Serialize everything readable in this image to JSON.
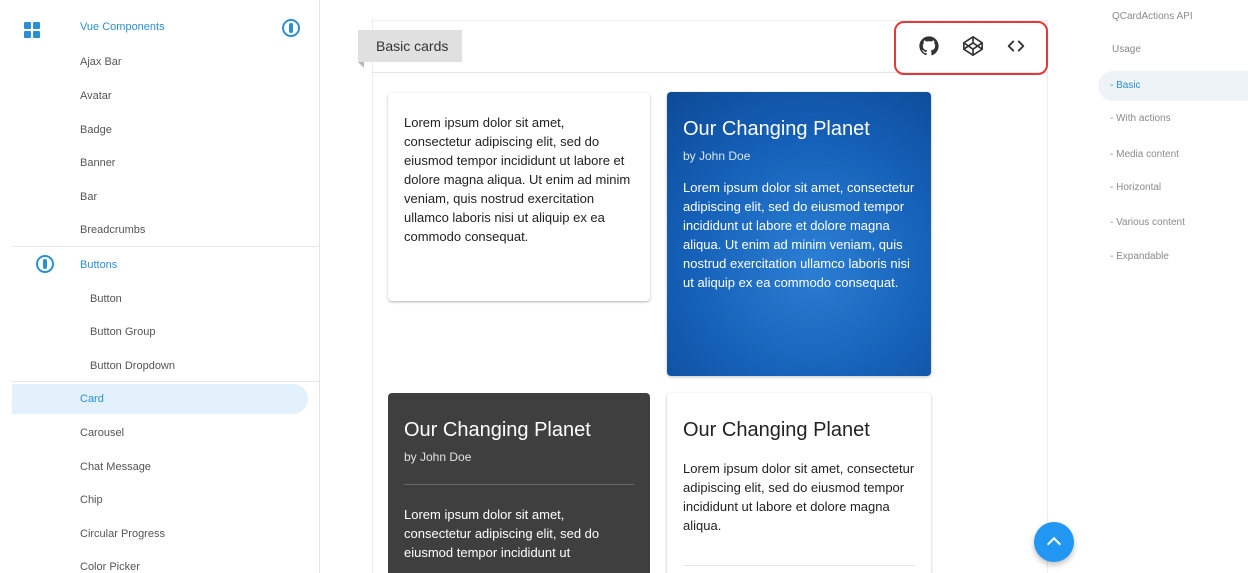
{
  "sidebar": {
    "section_label": "Vue Components",
    "items": [
      {
        "label": "Ajax Bar"
      },
      {
        "label": "Avatar"
      },
      {
        "label": "Badge"
      },
      {
        "label": "Banner"
      },
      {
        "label": "Bar"
      },
      {
        "label": "Breadcrumbs"
      }
    ],
    "group_label": "Buttons",
    "group_items": [
      {
        "label": "Button"
      },
      {
        "label": "Button Group"
      },
      {
        "label": "Button Dropdown"
      }
    ],
    "items2": [
      {
        "label": "Card"
      },
      {
        "label": "Carousel"
      },
      {
        "label": "Chat Message"
      },
      {
        "label": "Chip"
      },
      {
        "label": "Circular Progress"
      },
      {
        "label": "Color Picker"
      }
    ],
    "active_item": "Card",
    "accent_color": "#2b8fd6"
  },
  "main": {
    "section_title": "Basic cards",
    "icons": [
      "github-icon",
      "codepen-icon",
      "code-icon"
    ],
    "cards": [
      {
        "text": "Lorem ipsum dolor sit amet, consectetur adipiscing elit, sed do eiusmod tempor incididunt ut labore et dolore magna aliqua. Ut enim ad minim veniam, quis nostrud exercitation ullamco laboris nisi ut aliquip ex ea commodo consequat."
      },
      {
        "title": "Our Changing Planet",
        "subtitle": "by John Doe",
        "text": "Lorem ipsum dolor sit amet, consectetur adipiscing elit, sed do eiusmod tempor incididunt ut labore et dolore magna aliqua. Ut enim ad minim veniam, quis nostrud exercitation ullamco laboris nisi ut aliquip ex ea commodo consequat.",
        "color": "#1565c0"
      },
      {
        "title": "Our Changing Planet",
        "subtitle": "by John Doe",
        "text": "Lorem ipsum dolor sit amet, consectetur adipiscing elit, sed do eiusmod tempor incididunt ut",
        "color": "#3f3f3f"
      },
      {
        "title": "Our Changing Planet",
        "text": "Lorem ipsum dolor sit amet, consectetur adipiscing elit, sed do eiusmod tempor incididunt ut labore et dolore magna aliqua."
      }
    ]
  },
  "toc": {
    "items": [
      {
        "label": "QCardActions API"
      },
      {
        "label": "Usage"
      },
      {
        "label": "- Basic"
      },
      {
        "label": "- With actions"
      },
      {
        "label": "- Media content"
      },
      {
        "label": "- Horizontal"
      },
      {
        "label": "- Various content"
      },
      {
        "label": "- Expandable"
      }
    ],
    "active_item": "- Basic"
  },
  "colors": {
    "highlight_box": "#e53935",
    "fab": "#2196f3"
  }
}
